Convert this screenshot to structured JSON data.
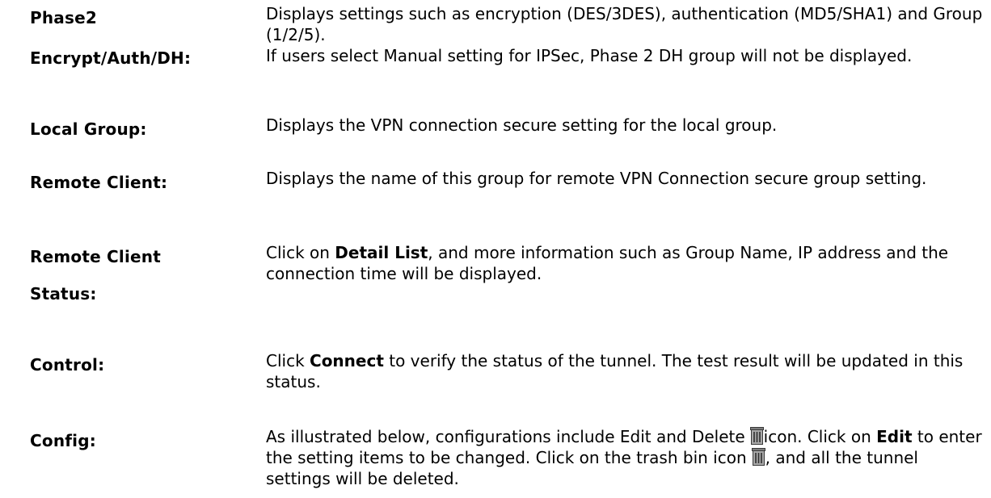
{
  "rows": [
    {
      "term_line1": "Phase2",
      "term_line2": "Encrypt/Auth/DH:",
      "def_line1": "Displays settings such as encryption (DES/3DES), authentication (MD5/SHA1) and Group (1/2/5).",
      "def_line2": "If users select Manual setting for IPSec, Phase 2 DH group will not be displayed."
    },
    {
      "term": "Local Group:",
      "def": "Displays the VPN connection secure setting for the local group."
    },
    {
      "term": "Remote Client:",
      "def": "Displays the name of this group for remote VPN Connection secure group setting."
    },
    {
      "term_line1": "Remote Client",
      "term_line2": "Status:",
      "def_pre": "Click on ",
      "def_bold": "Detail List",
      "def_post": ", and more information such as Group Name, IP address and the connection time will be displayed."
    },
    {
      "term": "Control:",
      "def_pre": "Click ",
      "def_bold": "Connect",
      "def_post": " to verify the status of the tunnel. The test result will be updated in this status."
    },
    {
      "term": "Config:",
      "def_part1": "As illustrated below, configurations include Edit and Delete",
      "def_part2": "icon. Click on ",
      "def_bold": "Edit",
      "def_part3": " to enter the setting items to be changed. Click on the trash bin icon",
      "def_part4": ", and all the tunnel settings will be deleted.",
      "icon": "trash-icon"
    }
  ]
}
